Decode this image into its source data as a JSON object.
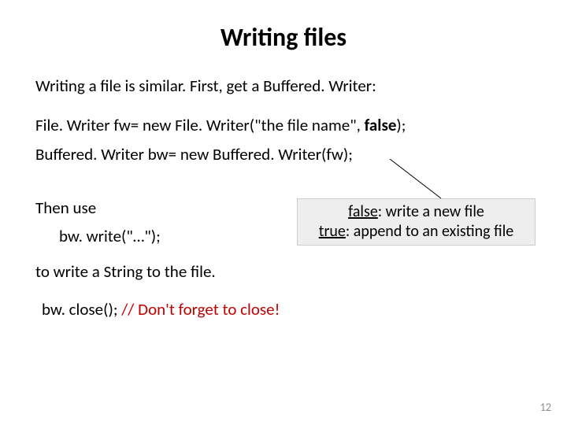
{
  "title": "Writing files",
  "intro": "Writing a file is similar. First, get a Buffered. Writer:",
  "code": {
    "line1_pre": "File. Writer fw= new File. Writer(\"the file name\", ",
    "line1_bold": "false",
    "line1_post": ");",
    "line2": "Buffered. Writer bw= new Buffered. Writer(fw);"
  },
  "thenuse": "Then use",
  "bwwrite": "bw. write(\"…\");",
  "towrite": "to write a String to the file.",
  "close_black": "bw. close();    ",
  "close_red": "// Don't forget to close!",
  "callout": {
    "false_label": "false",
    "false_text": ": write a new file",
    "true_label": "true",
    "true_text": ": append to an existing file"
  },
  "pagenum": "12"
}
